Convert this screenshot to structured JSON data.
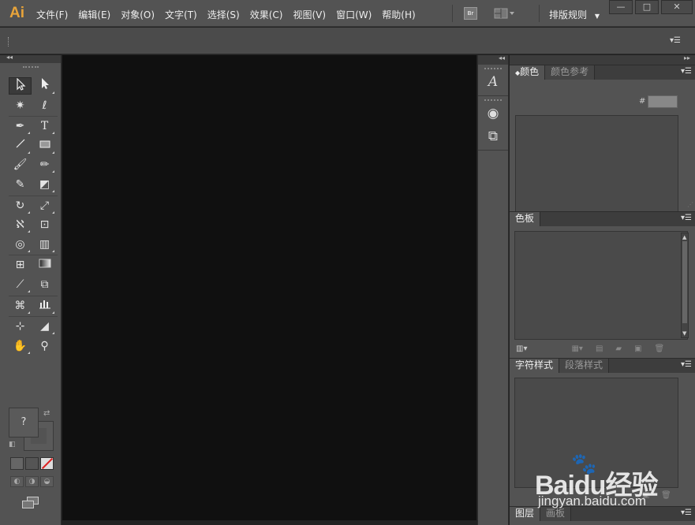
{
  "app": {
    "logo": "Ai"
  },
  "menubar": {
    "items": [
      "文件(F)",
      "编辑(E)",
      "对象(O)",
      "文字(T)",
      "选择(S)",
      "效果(C)",
      "视图(V)",
      "窗口(W)",
      "帮助(H)"
    ],
    "bridge_label": "Br",
    "workspace_label": "排版规则",
    "window_buttons": {
      "minimize": "—",
      "restore": "□",
      "close": "✕"
    }
  },
  "toolbox": {
    "rows": [
      [
        "selection-tool",
        "direct-selection-tool"
      ],
      [
        "magic-wand-tool",
        "lasso-tool"
      ],
      [
        "pen-tool",
        "type-tool"
      ],
      [
        "line-segment-tool",
        "rectangle-tool"
      ],
      [
        "paintbrush-tool",
        "pencil-tool"
      ],
      [
        "blob-brush-tool",
        "eraser-tool"
      ],
      [
        "rotate-tool",
        "scale-tool"
      ],
      [
        "warp-tool",
        "free-transform-tool"
      ],
      [
        "shape-builder-tool",
        "perspective-grid-tool"
      ],
      [
        "mesh-tool",
        "gradient-tool"
      ],
      [
        "eyedropper-tool",
        "blend-tool"
      ],
      [
        "symbol-sprayer-tool",
        "column-graph-tool"
      ],
      [
        "artboard-tool",
        "slice-tool"
      ],
      [
        "hand-tool",
        "zoom-tool"
      ]
    ],
    "fill_label": "?"
  },
  "icon_strip": {
    "icons": [
      "character-icon",
      "appearance-icon",
      "transform-icon"
    ]
  },
  "panels": {
    "color": {
      "tabs": [
        "颜色",
        "颜色参考"
      ],
      "hash_label": "#"
    },
    "swatches": {
      "tabs": [
        "色板"
      ]
    },
    "styles": {
      "tabs": [
        "字符样式",
        "段落样式"
      ]
    },
    "layers": {
      "tabs": [
        "图层",
        "画板"
      ]
    }
  },
  "watermark": {
    "brand": "Baidu经验",
    "url": "jingyan.baidu.com"
  },
  "colors": {
    "logo": "#e8a43a",
    "chrome": "#535353",
    "canvas": "#101010"
  }
}
